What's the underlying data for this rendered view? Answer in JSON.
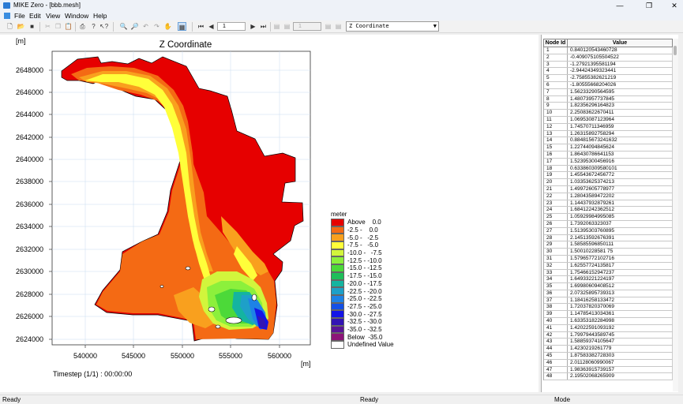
{
  "window": {
    "title": "MIKE Zero - [bbb.mesh]",
    "minimize": "—",
    "maximize": "❐",
    "close": "✕"
  },
  "menu": {
    "items": [
      "File",
      "Edit",
      "View",
      "Window",
      "Help"
    ]
  },
  "toolbar": {
    "timestep_spin": "1",
    "layer_spin": "1",
    "item_combo": "Z Coordinate",
    "icons": [
      "new-icon",
      "open-icon",
      "save-icon",
      "cut-icon",
      "copy-icon",
      "paste-icon",
      "print-icon",
      "info-icon",
      "context-help-icon",
      "zoom-in-icon",
      "zoom-out-icon",
      "zoom-prev-icon",
      "zoom-next-icon",
      "pan-icon",
      "grid-toggle-icon",
      "first-step-icon",
      "prev-step-icon",
      "next-step-icon",
      "last-step-icon"
    ]
  },
  "plot": {
    "title": "Z Coordinate",
    "x_unit": "[m]",
    "y_unit": "[m]",
    "y_ticks": [
      "2648000",
      "2646000",
      "2644000",
      "2642000",
      "2640000",
      "2638000",
      "2636000",
      "2634000",
      "2632000",
      "2630000",
      "2628000",
      "2626000",
      "2624000"
    ],
    "x_ticks": [
      "540000",
      "545000",
      "550000",
      "555000",
      "560000"
    ],
    "timestep": "Timestep (1/1) : 00:00:00"
  },
  "legend": {
    "title": "meter",
    "entries": [
      {
        "label": "Above    0.0",
        "color": "#e60000"
      },
      {
        "label": "-2.5 -    0.0",
        "color": "#f46a14"
      },
      {
        "label": "-5.0 -   -2.5",
        "color": "#f9a01e"
      },
      {
        "label": "-7.5 -   -5.0",
        "color": "#ffff3a"
      },
      {
        "label": "-10.0 -   -7.5",
        "color": "#d2f53c"
      },
      {
        "label": "-12.5 - -10.0",
        "color": "#8cf03c"
      },
      {
        "label": "-15.0 - -12.5",
        "color": "#4cd939"
      },
      {
        "label": "-17.5 - -15.0",
        "color": "#1ebe5a"
      },
      {
        "label": "-20.0 - -17.5",
        "color": "#14b4a0"
      },
      {
        "label": "-22.5 - -20.0",
        "color": "#1ea0c8"
      },
      {
        "label": "-25.0 - -22.5",
        "color": "#1e82e6"
      },
      {
        "label": "-27.5 - -25.0",
        "color": "#1450e6"
      },
      {
        "label": "-30.0 - -27.5",
        "color": "#1414e6"
      },
      {
        "label": "-32.5 - -30.0",
        "color": "#3214b4"
      },
      {
        "label": "-35.0 - -32.5",
        "color": "#5a1496"
      },
      {
        "label": "Below  -35.0",
        "color": "#8c1478"
      },
      {
        "label": "Undefined Value",
        "color": "#ffffff"
      }
    ]
  },
  "grid": {
    "headers": [
      "Node Id",
      "Value"
    ],
    "rows": [
      [
        "1",
        "0.840120543460728"
      ],
      [
        "2",
        "-0.409075105504522"
      ],
      [
        "3",
        "-1.27921395581194"
      ],
      [
        "4",
        "-2.94424349323441"
      ],
      [
        "5",
        "-2.75855382621219"
      ],
      [
        "6",
        "-1.80555668204026"
      ],
      [
        "7",
        "1.56233290564595"
      ],
      [
        "8",
        "1.48073957737845"
      ],
      [
        "9",
        "1.82356296164823"
      ],
      [
        "10",
        "2.25083622670411"
      ],
      [
        "11",
        "1.06953087123964"
      ],
      [
        "12",
        "1.74570711346959"
      ],
      [
        "13",
        "1.26315892758294"
      ],
      [
        "14",
        "0.884815673241632"
      ],
      [
        "15",
        "1.22744094845624"
      ],
      [
        "16",
        "1.86430786641153"
      ],
      [
        "17",
        "1.52395300456916"
      ],
      [
        "18",
        "0.633860309580101"
      ],
      [
        "19",
        "1.45543672456772"
      ],
      [
        "20",
        "1.03353625374213"
      ],
      [
        "21",
        "1.49972605778977"
      ],
      [
        "22",
        "1.28043589472202"
      ],
      [
        "23",
        "1.14437932879261"
      ],
      [
        "24",
        "1.68412242362512"
      ],
      [
        "25",
        "1.05929984995085"
      ],
      [
        "26",
        "1.7392063323037"
      ],
      [
        "27",
        "1.51395303760895"
      ],
      [
        "28",
        "2.14513592676391"
      ],
      [
        "29",
        "1.58585596850111"
      ],
      [
        "30",
        "1.50010228581 75"
      ],
      [
        "31",
        "1.57965772102716"
      ],
      [
        "32",
        "1.62557724135817"
      ],
      [
        "33",
        "1.75466152947237"
      ],
      [
        "34",
        "1.64933221224197"
      ],
      [
        "35",
        "1.69980609408512"
      ],
      [
        "36",
        "2.07325895739313"
      ],
      [
        "37",
        "1.18416258133472"
      ],
      [
        "38",
        "1.72037820370069"
      ],
      [
        "39",
        "1.14785413034361"
      ],
      [
        "40",
        "1.63353182284998"
      ],
      [
        "41",
        "1.42022591093192"
      ],
      [
        "42",
        "1.79979443589745"
      ],
      [
        "43",
        "1.58859374105647"
      ],
      [
        "44",
        "1.4230219261779"
      ],
      [
        "45",
        "1.87583382728303"
      ],
      [
        "46",
        "2.01128060990067"
      ],
      [
        "47",
        "1.98363915739157"
      ],
      [
        "48",
        "2.19502068265909"
      ]
    ]
  },
  "status": {
    "left": "Ready",
    "center": "Ready",
    "right": "Mode"
  }
}
